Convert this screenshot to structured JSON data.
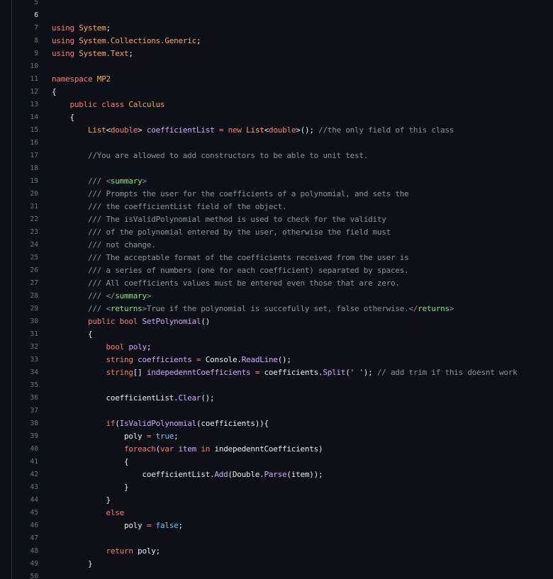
{
  "editor": {
    "active_line": 6,
    "colors": {
      "background": "#0d1117",
      "keyword": "#ff7b72",
      "type": "#ffa657",
      "function": "#d2a8ff",
      "comment": "#8b949e",
      "xml_tag": "#7ee787",
      "constant": "#79c0ff",
      "string": "#a5d6ff",
      "text": "#e6edf3"
    },
    "lines": [
      {
        "n": "5",
        "tokens": []
      },
      {
        "n": "6",
        "tokens": []
      },
      {
        "n": "7",
        "tokens": [
          [
            "kw",
            "using"
          ],
          [
            "pl",
            " "
          ],
          [
            "ty",
            "System"
          ],
          [
            "pl",
            ";"
          ]
        ]
      },
      {
        "n": "8",
        "tokens": [
          [
            "kw",
            "using"
          ],
          [
            "pl",
            " "
          ],
          [
            "ty",
            "System.Collections.Generic"
          ],
          [
            "pl",
            ";"
          ]
        ]
      },
      {
        "n": "9",
        "tokens": [
          [
            "kw",
            "using"
          ],
          [
            "pl",
            " "
          ],
          [
            "ty",
            "System.Text"
          ],
          [
            "pl",
            ";"
          ]
        ]
      },
      {
        "n": "10",
        "tokens": []
      },
      {
        "n": "11",
        "tokens": [
          [
            "kw",
            "namespace"
          ],
          [
            "pl",
            " "
          ],
          [
            "ty",
            "MP2"
          ]
        ]
      },
      {
        "n": "12",
        "tokens": [
          [
            "pl",
            "{"
          ]
        ]
      },
      {
        "n": "13",
        "tokens": [
          [
            "pl",
            "    "
          ],
          [
            "kw",
            "public"
          ],
          [
            "pl",
            " "
          ],
          [
            "kw",
            "class"
          ],
          [
            "pl",
            " "
          ],
          [
            "ty",
            "Calculus"
          ]
        ]
      },
      {
        "n": "14",
        "tokens": [
          [
            "pl",
            "    {"
          ]
        ]
      },
      {
        "n": "15",
        "tokens": [
          [
            "pl",
            "        "
          ],
          [
            "ty",
            "List"
          ],
          [
            "pl",
            "<"
          ],
          [
            "kw",
            "double"
          ],
          [
            "pl",
            "> "
          ],
          [
            "fn",
            "coefficientList"
          ],
          [
            "pl",
            " "
          ],
          [
            "kw",
            "="
          ],
          [
            "pl",
            " "
          ],
          [
            "kw",
            "new"
          ],
          [
            "pl",
            " "
          ],
          [
            "ty",
            "List"
          ],
          [
            "pl",
            "<"
          ],
          [
            "kw",
            "double"
          ],
          [
            "pl",
            ">(); "
          ],
          [
            "cm",
            "//the only field of this class"
          ]
        ]
      },
      {
        "n": "16",
        "tokens": []
      },
      {
        "n": "17",
        "tokens": [
          [
            "pl",
            "        "
          ],
          [
            "cm",
            "//You are allowed to add constructors to be able to unit test."
          ]
        ]
      },
      {
        "n": "18",
        "tokens": []
      },
      {
        "n": "19",
        "tokens": [
          [
            "pl",
            "        "
          ],
          [
            "cm",
            "/// <"
          ],
          [
            "tg",
            "summary"
          ],
          [
            "cm",
            ">"
          ]
        ]
      },
      {
        "n": "20",
        "tokens": [
          [
            "pl",
            "        "
          ],
          [
            "cm",
            "/// Prompts the user for the coefficients of a polynomial, and sets the"
          ]
        ]
      },
      {
        "n": "21",
        "tokens": [
          [
            "pl",
            "        "
          ],
          [
            "cm",
            "/// the coefficientList field of the object."
          ]
        ]
      },
      {
        "n": "22",
        "tokens": [
          [
            "pl",
            "        "
          ],
          [
            "cm",
            "/// The isValidPolynomial method is used to check for the validity"
          ]
        ]
      },
      {
        "n": "23",
        "tokens": [
          [
            "pl",
            "        "
          ],
          [
            "cm",
            "/// of the polynomial entered by the user, otherwise the field must"
          ]
        ]
      },
      {
        "n": "24",
        "tokens": [
          [
            "pl",
            "        "
          ],
          [
            "cm",
            "/// not change."
          ]
        ]
      },
      {
        "n": "25",
        "tokens": [
          [
            "pl",
            "        "
          ],
          [
            "cm",
            "/// The acceptable format of the coefficients received from the user is"
          ]
        ]
      },
      {
        "n": "26",
        "tokens": [
          [
            "pl",
            "        "
          ],
          [
            "cm",
            "/// a series of numbers (one for each coefficient) separated by spaces."
          ]
        ]
      },
      {
        "n": "27",
        "tokens": [
          [
            "pl",
            "        "
          ],
          [
            "cm",
            "/// All coefficients values must be entered even those that are zero."
          ]
        ]
      },
      {
        "n": "28",
        "tokens": [
          [
            "pl",
            "        "
          ],
          [
            "cm",
            "/// </"
          ],
          [
            "tg",
            "summary"
          ],
          [
            "cm",
            ">"
          ]
        ]
      },
      {
        "n": "29",
        "tokens": [
          [
            "pl",
            "        "
          ],
          [
            "cm",
            "/// <"
          ],
          [
            "tg",
            "returns"
          ],
          [
            "cm",
            ">True if the polynomial is succefully set, false otherwise.</"
          ],
          [
            "tg",
            "returns"
          ],
          [
            "cm",
            ">"
          ]
        ]
      },
      {
        "n": "30",
        "tokens": [
          [
            "pl",
            "        "
          ],
          [
            "kw",
            "public"
          ],
          [
            "pl",
            " "
          ],
          [
            "kw",
            "bool"
          ],
          [
            "pl",
            " "
          ],
          [
            "fn",
            "SetPolynomial"
          ],
          [
            "pl",
            "()"
          ]
        ]
      },
      {
        "n": "31",
        "tokens": [
          [
            "pl",
            "        {"
          ]
        ]
      },
      {
        "n": "32",
        "tokens": [
          [
            "pl",
            "            "
          ],
          [
            "kw",
            "bool"
          ],
          [
            "pl",
            " "
          ],
          [
            "fn",
            "poly"
          ],
          [
            "pl",
            ";"
          ]
        ]
      },
      {
        "n": "33",
        "tokens": [
          [
            "pl",
            "            "
          ],
          [
            "kw",
            "string"
          ],
          [
            "pl",
            " "
          ],
          [
            "fn",
            "coefficients"
          ],
          [
            "pl",
            " "
          ],
          [
            "kw",
            "="
          ],
          [
            "pl",
            " Console."
          ],
          [
            "fn",
            "ReadLine"
          ],
          [
            "pl",
            "();"
          ]
        ]
      },
      {
        "n": "34",
        "tokens": [
          [
            "pl",
            "            "
          ],
          [
            "kw",
            "string"
          ],
          [
            "pl",
            "[] "
          ],
          [
            "fn",
            "indepedenntCoefficients"
          ],
          [
            "pl",
            " "
          ],
          [
            "kw",
            "="
          ],
          [
            "pl",
            " coefficients."
          ],
          [
            "fn",
            "Split"
          ],
          [
            "pl",
            "("
          ],
          [
            "st",
            "' '"
          ],
          [
            "pl",
            "); "
          ],
          [
            "cm",
            "// add trim if this doesnt work"
          ]
        ]
      },
      {
        "n": "35",
        "tokens": []
      },
      {
        "n": "36",
        "tokens": [
          [
            "pl",
            "            coefficientList."
          ],
          [
            "fn",
            "Clear"
          ],
          [
            "pl",
            "();"
          ]
        ]
      },
      {
        "n": "37",
        "tokens": []
      },
      {
        "n": "38",
        "tokens": [
          [
            "pl",
            "            "
          ],
          [
            "kw",
            "if"
          ],
          [
            "pl",
            "("
          ],
          [
            "fn",
            "IsValidPolynomial"
          ],
          [
            "pl",
            "(coefficients)){"
          ]
        ]
      },
      {
        "n": "39",
        "tokens": [
          [
            "pl",
            "                poly "
          ],
          [
            "kw",
            "="
          ],
          [
            "pl",
            " "
          ],
          [
            "ct",
            "true"
          ],
          [
            "pl",
            ";"
          ]
        ]
      },
      {
        "n": "40",
        "tokens": [
          [
            "pl",
            "                "
          ],
          [
            "kw",
            "foreach"
          ],
          [
            "pl",
            "("
          ],
          [
            "kw",
            "var"
          ],
          [
            "pl",
            " "
          ],
          [
            "fn",
            "item"
          ],
          [
            "pl",
            " "
          ],
          [
            "kw",
            "in"
          ],
          [
            "pl",
            " indepedenntCoefficients)"
          ]
        ]
      },
      {
        "n": "41",
        "tokens": [
          [
            "pl",
            "                {"
          ]
        ]
      },
      {
        "n": "42",
        "tokens": [
          [
            "pl",
            "                    coefficientList."
          ],
          [
            "fn",
            "Add"
          ],
          [
            "pl",
            "(Double."
          ],
          [
            "fn",
            "Parse"
          ],
          [
            "pl",
            "(item));"
          ]
        ]
      },
      {
        "n": "43",
        "tokens": [
          [
            "pl",
            "                }"
          ]
        ]
      },
      {
        "n": "44",
        "tokens": [
          [
            "pl",
            "            }"
          ]
        ]
      },
      {
        "n": "45",
        "tokens": [
          [
            "pl",
            "            "
          ],
          [
            "kw",
            "else"
          ]
        ]
      },
      {
        "n": "46",
        "tokens": [
          [
            "pl",
            "                poly "
          ],
          [
            "kw",
            "="
          ],
          [
            "pl",
            " "
          ],
          [
            "ct",
            "false"
          ],
          [
            "pl",
            ";"
          ]
        ]
      },
      {
        "n": "47",
        "tokens": []
      },
      {
        "n": "48",
        "tokens": [
          [
            "pl",
            "            "
          ],
          [
            "kw",
            "return"
          ],
          [
            "pl",
            " poly;"
          ]
        ]
      },
      {
        "n": "49",
        "tokens": [
          [
            "pl",
            "        }"
          ]
        ]
      },
      {
        "n": "50",
        "tokens": []
      }
    ]
  }
}
